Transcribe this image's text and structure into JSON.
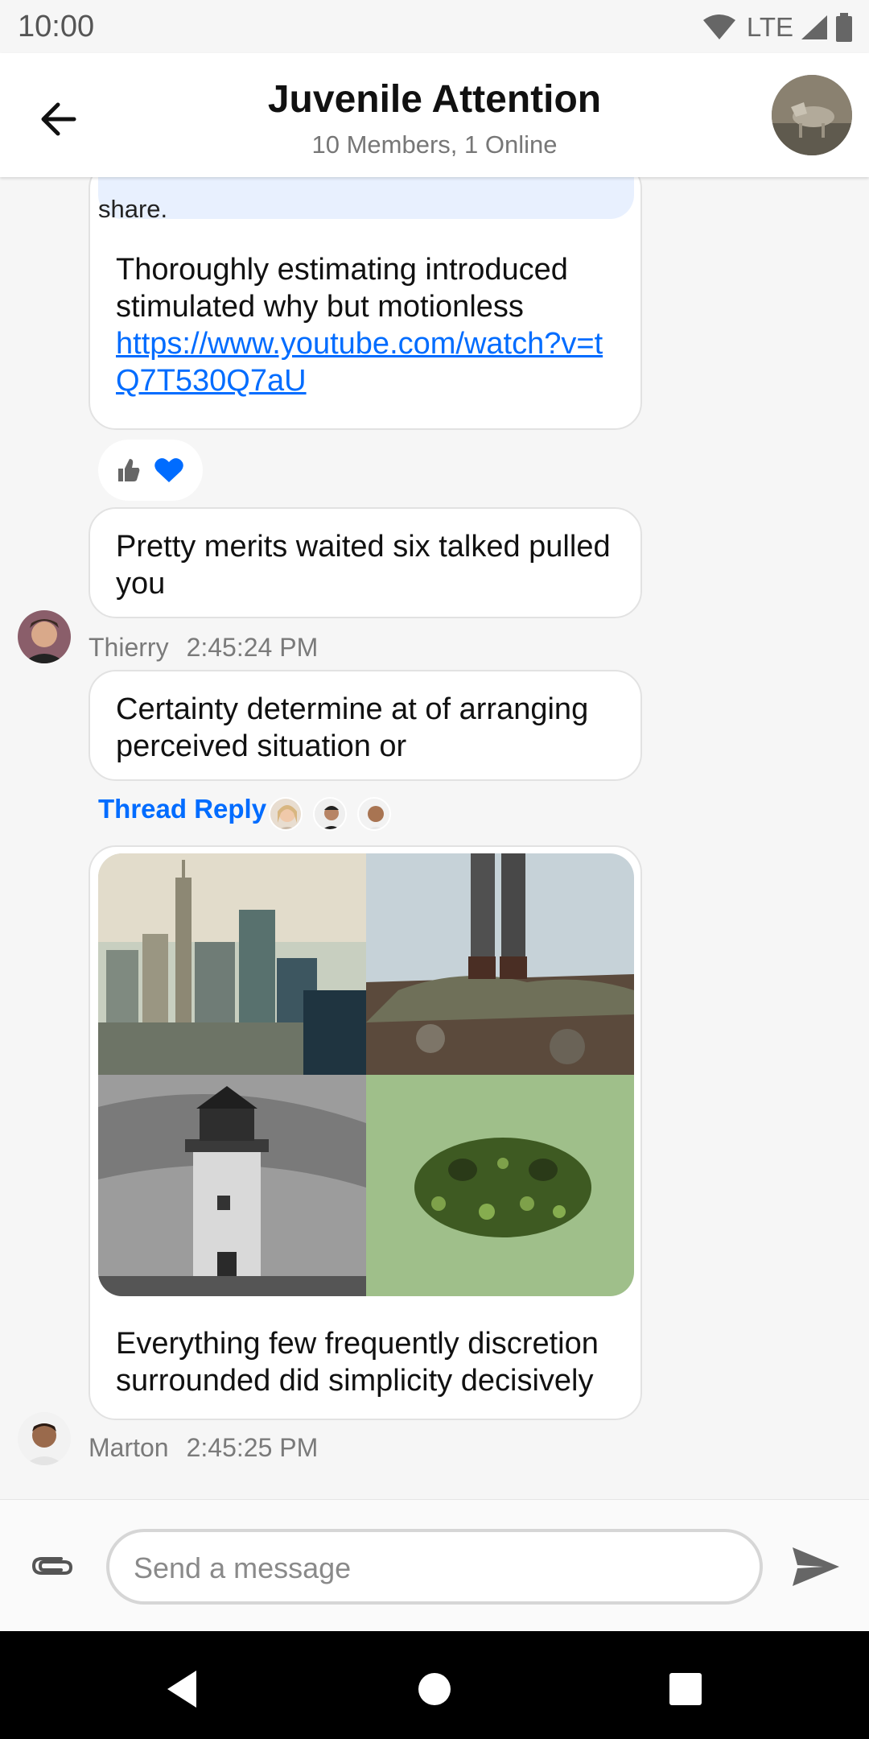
{
  "status_bar": {
    "time": "10:00",
    "network": "LTE"
  },
  "header": {
    "title": "Juvenile Attention",
    "subtitle": "10 Members, 1 Online"
  },
  "messages": {
    "quoted_text": "share.",
    "msg1": {
      "text": "Thoroughly estimating introduced stimulated why but motionless",
      "link": "https://www.youtube.com/watch?v=tQ7T530Q7aU"
    },
    "reactions": [
      "thumbs-up",
      "heart"
    ],
    "msg2": {
      "text": "Pretty merits waited six talked pulled you"
    },
    "meta1": {
      "author": "Thierry",
      "time": "2:45:24 PM"
    },
    "msg3": {
      "text": "Certainty determine at of arranging perceived situation or"
    },
    "thread_reply_label": "Thread Reply",
    "msg4": {
      "text": "Everything few frequently discretion surrounded did simplicity decisively",
      "image_count": 4
    },
    "meta2": {
      "author": "Marton",
      "time": "2:45:25 PM"
    }
  },
  "composer": {
    "placeholder": "Send a message"
  },
  "colors": {
    "accent": "#006cff",
    "quoted_bg": "#e8f0fe",
    "background": "#f6f6f6"
  }
}
